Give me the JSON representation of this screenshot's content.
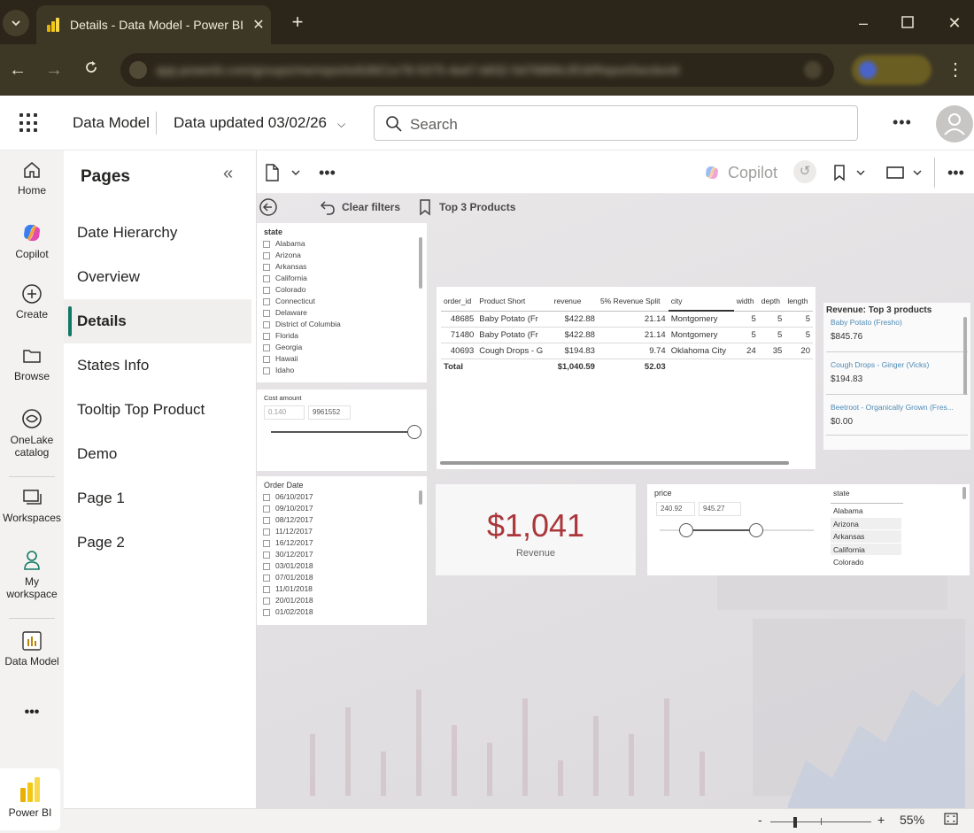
{
  "browser": {
    "tab_title": "Details - Data Model - Power BI",
    "url": "app.powerbi.com/groups/me/reports/b3821e78-5375-4a47-b832-5d76889c3f18/ReportSection6",
    "profile": "Default"
  },
  "header": {
    "workspace": "Data Model",
    "data_updated": "Data updated 03/02/26",
    "search_placeholder": "Search"
  },
  "rail": {
    "home": "Home",
    "copilot": "Copilot",
    "create": "Create",
    "browse": "Browse",
    "onelake1": "OneLake",
    "onelake2": "catalog",
    "workspaces": "Workspaces",
    "myws1": "My",
    "myws2": "workspace",
    "datamodel": "Data Model",
    "more": "•••",
    "powerbi": "Power BI"
  },
  "pages": {
    "title": "Pages",
    "items": [
      "Date Hierarchy",
      "Overview",
      "Details",
      "States Info",
      "Tooltip Top Product",
      "Demo",
      "Page 1",
      "Page 2"
    ],
    "active": "Details"
  },
  "toolbar": {
    "copilot": "Copilot"
  },
  "canvas": {
    "clear_filters": "Clear filters",
    "bookmark": "Top 3 Products",
    "state_slicer": {
      "title": "state",
      "items": [
        "Alabama",
        "Arizona",
        "Arkansas",
        "California",
        "Colorado",
        "Connecticut",
        "Delaware",
        "District of Columbia",
        "Florida",
        "Georgia",
        "Hawaii",
        "Idaho"
      ]
    },
    "cost_slicer": {
      "title": "Cost amount",
      "min": "0.140",
      "max": "9961552"
    },
    "date_slicer": {
      "title": "Order Date",
      "items": [
        "06/10/2017",
        "09/10/2017",
        "08/12/2017",
        "11/12/2017",
        "16/12/2017",
        "30/12/2017",
        "03/01/2018",
        "07/01/2018",
        "11/01/2018",
        "20/01/2018",
        "01/02/2018"
      ]
    },
    "table": {
      "headers": [
        "order_id",
        "Product Short",
        "revenue",
        "5% Revenue Split",
        "city",
        "width",
        "depth",
        "length"
      ],
      "rows": [
        [
          "48685",
          "Baby Potato (Fr",
          "$422.88",
          "21.14",
          "Montgomery",
          "5",
          "5",
          "5"
        ],
        [
          "71480",
          "Baby Potato (Fr",
          "$422.88",
          "21.14",
          "Montgomery",
          "5",
          "5",
          "5"
        ],
        [
          "40693",
          "Cough Drops - G",
          "$194.83",
          "9.74",
          "Oklahoma City",
          "24",
          "35",
          "20"
        ]
      ],
      "total_label": "Total",
      "total_revenue": "$1,040.59",
      "total_split": "52.03"
    },
    "top3": {
      "title": "Revenue: Top 3 products",
      "items": [
        {
          "name": "Baby Potato (Fresho)",
          "value": "$845.76"
        },
        {
          "name": "Cough Drops - Ginger (Vicks)",
          "value": "$194.83"
        },
        {
          "name": "Beetroot - Organically Grown (Fres...",
          "value": "$0.00"
        }
      ]
    },
    "card": {
      "value": "$1,041",
      "label": "Revenue"
    },
    "price_slicer": {
      "title": "price",
      "min": "240.92",
      "max": "945.27"
    },
    "state_list": {
      "title": "state",
      "items": [
        "Alabama",
        "Arizona",
        "Arkansas",
        "California",
        "Colorado"
      ]
    }
  },
  "status": {
    "minus": "-",
    "plus": "+",
    "zoom": "55%"
  },
  "colors": {
    "accent": "#117865",
    "card_value": "#a9373b",
    "link": "#4d8ab5",
    "browser_bg": "#2b2619"
  }
}
